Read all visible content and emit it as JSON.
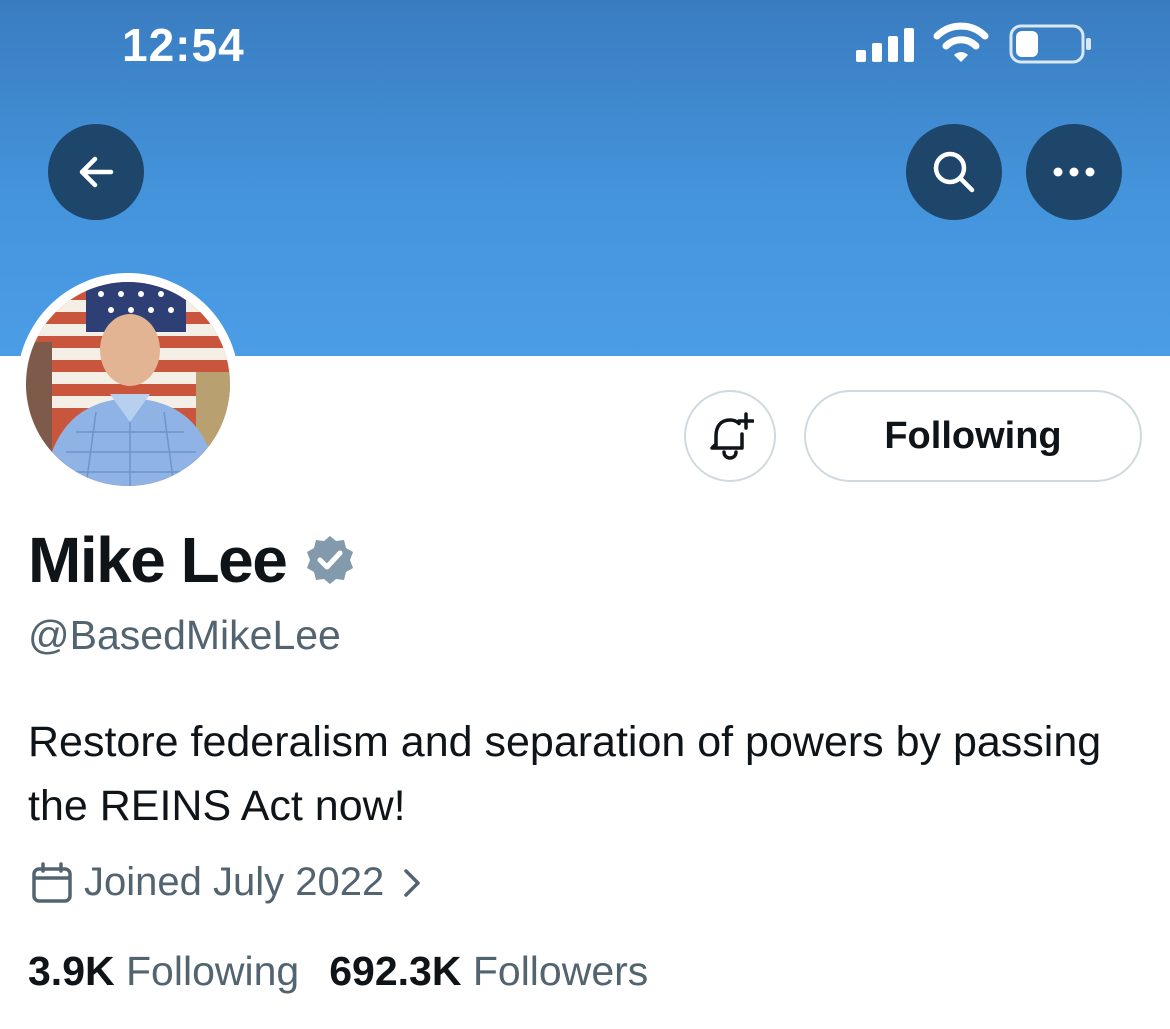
{
  "status_bar": {
    "time": "12:54"
  },
  "header": {
    "back_icon": "arrow-left-icon",
    "search_icon": "search-icon",
    "more_icon": "ellipsis-icon",
    "banner_color": "#4494dc",
    "button_color": "#1e456a"
  },
  "profile": {
    "display_name": "Mike Lee",
    "handle": "@BasedMikeLee",
    "bio": "Restore federalism and separation of powers by passing the REINS Act now!",
    "joined": "Joined July 2022",
    "verified_badge_color": "#829aab"
  },
  "actions": {
    "notify_icon": "bell-plus-icon",
    "following_label": "Following"
  },
  "stats": {
    "following_count": "3.9K",
    "following_label": "Following",
    "followers_count": "692.3K",
    "followers_label": "Followers"
  }
}
